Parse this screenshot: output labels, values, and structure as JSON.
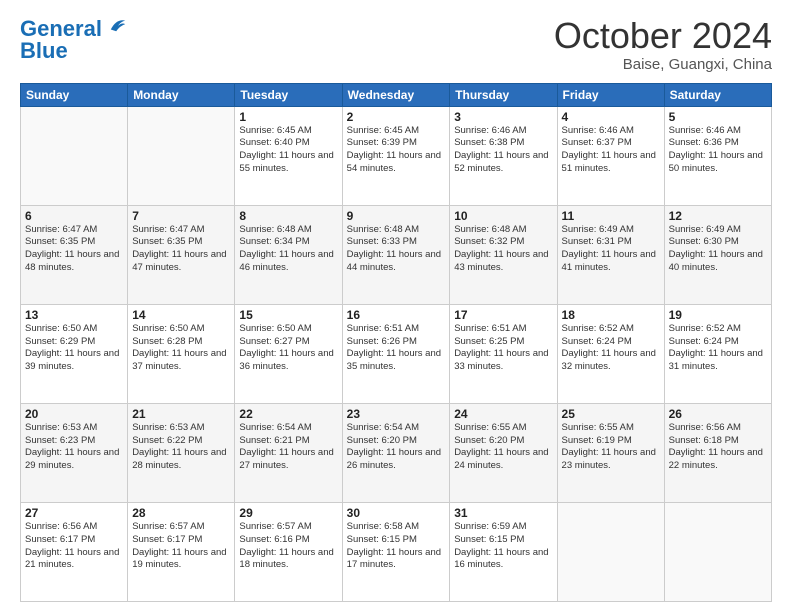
{
  "header": {
    "logo_text1": "General",
    "logo_text2": "Blue",
    "month": "October 2024",
    "location": "Baise, Guangxi, China"
  },
  "days_of_week": [
    "Sunday",
    "Monday",
    "Tuesday",
    "Wednesday",
    "Thursday",
    "Friday",
    "Saturday"
  ],
  "weeks": [
    [
      {
        "day": "",
        "info": ""
      },
      {
        "day": "",
        "info": ""
      },
      {
        "day": "1",
        "info": "Sunrise: 6:45 AM\nSunset: 6:40 PM\nDaylight: 11 hours and 55 minutes."
      },
      {
        "day": "2",
        "info": "Sunrise: 6:45 AM\nSunset: 6:39 PM\nDaylight: 11 hours and 54 minutes."
      },
      {
        "day": "3",
        "info": "Sunrise: 6:46 AM\nSunset: 6:38 PM\nDaylight: 11 hours and 52 minutes."
      },
      {
        "day": "4",
        "info": "Sunrise: 6:46 AM\nSunset: 6:37 PM\nDaylight: 11 hours and 51 minutes."
      },
      {
        "day": "5",
        "info": "Sunrise: 6:46 AM\nSunset: 6:36 PM\nDaylight: 11 hours and 50 minutes."
      }
    ],
    [
      {
        "day": "6",
        "info": "Sunrise: 6:47 AM\nSunset: 6:35 PM\nDaylight: 11 hours and 48 minutes."
      },
      {
        "day": "7",
        "info": "Sunrise: 6:47 AM\nSunset: 6:35 PM\nDaylight: 11 hours and 47 minutes."
      },
      {
        "day": "8",
        "info": "Sunrise: 6:48 AM\nSunset: 6:34 PM\nDaylight: 11 hours and 46 minutes."
      },
      {
        "day": "9",
        "info": "Sunrise: 6:48 AM\nSunset: 6:33 PM\nDaylight: 11 hours and 44 minutes."
      },
      {
        "day": "10",
        "info": "Sunrise: 6:48 AM\nSunset: 6:32 PM\nDaylight: 11 hours and 43 minutes."
      },
      {
        "day": "11",
        "info": "Sunrise: 6:49 AM\nSunset: 6:31 PM\nDaylight: 11 hours and 41 minutes."
      },
      {
        "day": "12",
        "info": "Sunrise: 6:49 AM\nSunset: 6:30 PM\nDaylight: 11 hours and 40 minutes."
      }
    ],
    [
      {
        "day": "13",
        "info": "Sunrise: 6:50 AM\nSunset: 6:29 PM\nDaylight: 11 hours and 39 minutes."
      },
      {
        "day": "14",
        "info": "Sunrise: 6:50 AM\nSunset: 6:28 PM\nDaylight: 11 hours and 37 minutes."
      },
      {
        "day": "15",
        "info": "Sunrise: 6:50 AM\nSunset: 6:27 PM\nDaylight: 11 hours and 36 minutes."
      },
      {
        "day": "16",
        "info": "Sunrise: 6:51 AM\nSunset: 6:26 PM\nDaylight: 11 hours and 35 minutes."
      },
      {
        "day": "17",
        "info": "Sunrise: 6:51 AM\nSunset: 6:25 PM\nDaylight: 11 hours and 33 minutes."
      },
      {
        "day": "18",
        "info": "Sunrise: 6:52 AM\nSunset: 6:24 PM\nDaylight: 11 hours and 32 minutes."
      },
      {
        "day": "19",
        "info": "Sunrise: 6:52 AM\nSunset: 6:24 PM\nDaylight: 11 hours and 31 minutes."
      }
    ],
    [
      {
        "day": "20",
        "info": "Sunrise: 6:53 AM\nSunset: 6:23 PM\nDaylight: 11 hours and 29 minutes."
      },
      {
        "day": "21",
        "info": "Sunrise: 6:53 AM\nSunset: 6:22 PM\nDaylight: 11 hours and 28 minutes."
      },
      {
        "day": "22",
        "info": "Sunrise: 6:54 AM\nSunset: 6:21 PM\nDaylight: 11 hours and 27 minutes."
      },
      {
        "day": "23",
        "info": "Sunrise: 6:54 AM\nSunset: 6:20 PM\nDaylight: 11 hours and 26 minutes."
      },
      {
        "day": "24",
        "info": "Sunrise: 6:55 AM\nSunset: 6:20 PM\nDaylight: 11 hours and 24 minutes."
      },
      {
        "day": "25",
        "info": "Sunrise: 6:55 AM\nSunset: 6:19 PM\nDaylight: 11 hours and 23 minutes."
      },
      {
        "day": "26",
        "info": "Sunrise: 6:56 AM\nSunset: 6:18 PM\nDaylight: 11 hours and 22 minutes."
      }
    ],
    [
      {
        "day": "27",
        "info": "Sunrise: 6:56 AM\nSunset: 6:17 PM\nDaylight: 11 hours and 21 minutes."
      },
      {
        "day": "28",
        "info": "Sunrise: 6:57 AM\nSunset: 6:17 PM\nDaylight: 11 hours and 19 minutes."
      },
      {
        "day": "29",
        "info": "Sunrise: 6:57 AM\nSunset: 6:16 PM\nDaylight: 11 hours and 18 minutes."
      },
      {
        "day": "30",
        "info": "Sunrise: 6:58 AM\nSunset: 6:15 PM\nDaylight: 11 hours and 17 minutes."
      },
      {
        "day": "31",
        "info": "Sunrise: 6:59 AM\nSunset: 6:15 PM\nDaylight: 11 hours and 16 minutes."
      },
      {
        "day": "",
        "info": ""
      },
      {
        "day": "",
        "info": ""
      }
    ]
  ]
}
